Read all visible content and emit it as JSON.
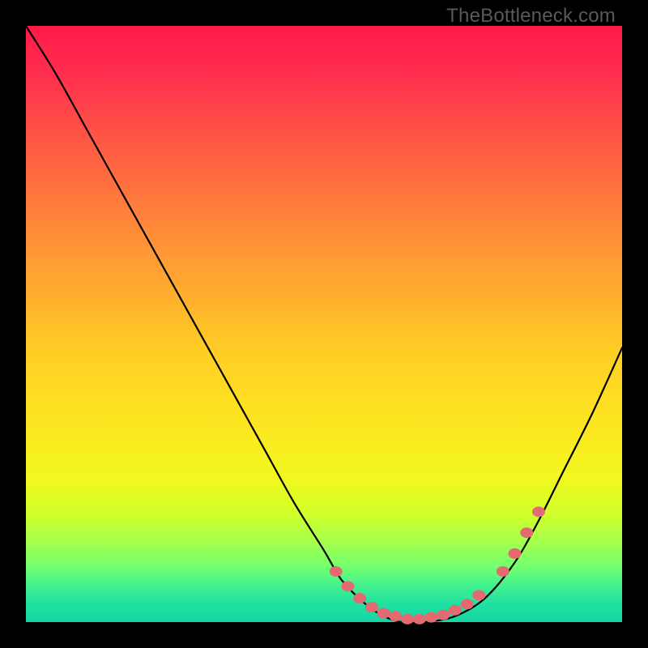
{
  "watermark": "TheBottleneck.com",
  "chart_data": {
    "type": "line",
    "title": "",
    "xlabel": "",
    "ylabel": "",
    "xlim": [
      0,
      100
    ],
    "ylim": [
      0,
      100
    ],
    "series": [
      {
        "name": "bottleneck-curve",
        "x": [
          0,
          5,
          10,
          15,
          20,
          25,
          30,
          35,
          40,
          45,
          50,
          53,
          57,
          60,
          63,
          67,
          72,
          77,
          82,
          86,
          90,
          95,
          100
        ],
        "y": [
          100,
          92,
          83,
          74,
          65,
          56,
          47,
          38,
          29,
          20,
          12,
          7,
          3,
          1,
          0,
          0,
          1,
          4,
          10,
          17,
          25,
          35,
          46
        ]
      }
    ],
    "markers": {
      "name": "highlight-points",
      "color": "#e46a72",
      "x": [
        52,
        54,
        56,
        58,
        60,
        62,
        64,
        66,
        68,
        70,
        72,
        74,
        76,
        80,
        82,
        84,
        86
      ],
      "y": [
        8.5,
        6,
        4,
        2.5,
        1.5,
        1,
        0.5,
        0.5,
        0.8,
        1.2,
        2,
        3,
        4.5,
        8.5,
        11.5,
        15,
        18.5
      ]
    }
  }
}
